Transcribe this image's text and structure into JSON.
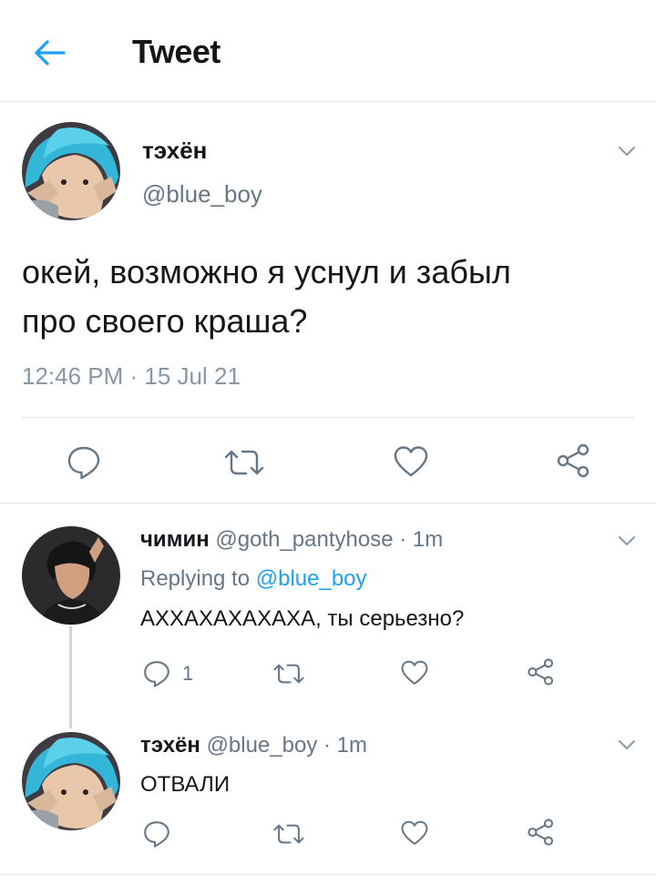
{
  "header": {
    "title": "Tweet",
    "back_icon": "arrow-left-icon"
  },
  "main_tweet": {
    "name": "тэхён",
    "handle": "@blue_boy",
    "text_line1": "окей, возможно я уснул и забыл",
    "text_line2": "про своего краша?",
    "timestamp": "12:46 PM · 15 Jul 21"
  },
  "reply1": {
    "name": "чимин",
    "handle": "@goth_pantyhose",
    "sep": " · ",
    "time": "1m",
    "replying_prefix": "Replying to ",
    "replying_to": "@blue_boy",
    "text": "АХХАХАХАХАХА, ты серьезно?",
    "reply_count": "1"
  },
  "reply2": {
    "name": "тэхён",
    "handle": "@blue_boy",
    "sep": " · ",
    "time": "1m",
    "text": "ОТВАЛИ"
  },
  "colors": {
    "accent": "#1da1f2",
    "muted": "#657786",
    "icon": "#657786",
    "divider": "#e1e8ed"
  }
}
